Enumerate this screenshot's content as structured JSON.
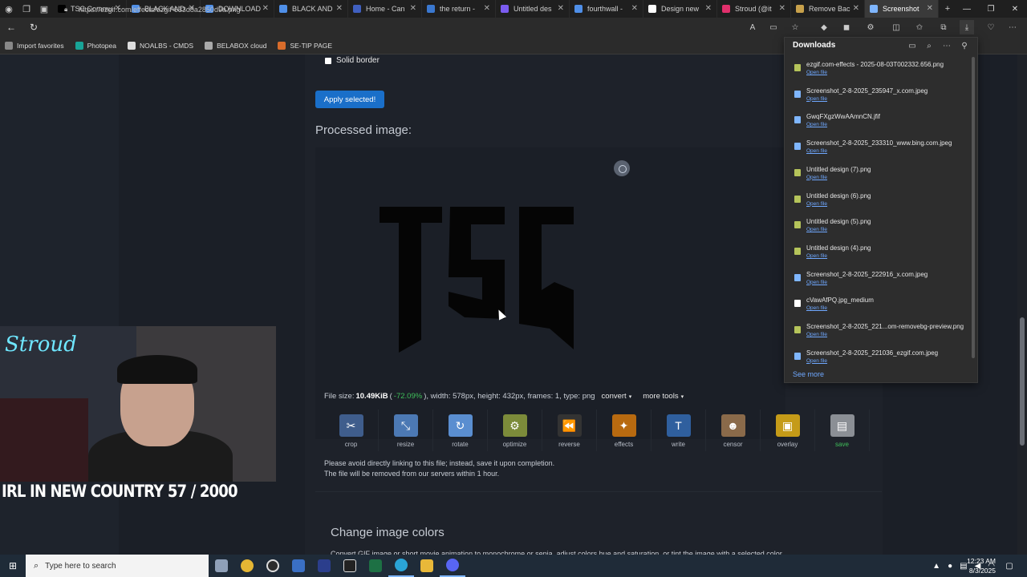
{
  "browser": {
    "tabs": [
      {
        "label": "TSC Commu",
        "color": "#000000"
      },
      {
        "label": "BLACK AND",
        "color": "#4f8fe8"
      },
      {
        "label": "DOWNLOAD",
        "color": "#4f8fe8"
      },
      {
        "label": "BLACK AND",
        "color": "#4f8fe8"
      },
      {
        "label": "Home - Can",
        "color": "#4060c0"
      },
      {
        "label": "the return -",
        "color": "#3a78d0"
      },
      {
        "label": "Untitled des",
        "color": "#7b5cf0"
      },
      {
        "label": "fourthwall -",
        "color": "#4f8fe8"
      },
      {
        "label": "Design new",
        "color": "#ffffff"
      },
      {
        "label": "Stroud (@it",
        "color": "#e1306c"
      },
      {
        "label": "Remove Bac",
        "color": "#c8a14b"
      },
      {
        "label": "Screenshot",
        "color": "#7fb6ff"
      }
    ],
    "new_tab": "+",
    "url": "https://ezgif.com/effects/ezgif-633d8a2850d9a.png",
    "window_controls": {
      "minimize": "—",
      "maximize": "❐",
      "close": "✕"
    }
  },
  "bookmarks": [
    {
      "label": "Import favorites",
      "color": "#888888"
    },
    {
      "label": "Photopea",
      "color": "#18a497"
    },
    {
      "label": "NOALBS - CMDS",
      "color": "#dddddd"
    },
    {
      "label": "BELABOX cloud",
      "color": "#aaaaaa"
    },
    {
      "label": "SE-TIP PAGE",
      "color": "#d96c2b"
    }
  ],
  "page": {
    "checkbox_label": "Solid border",
    "apply_button": "Apply selected!",
    "processed_title": "Processed image:",
    "image_text": "TSC",
    "file_info": {
      "prefix": "File size:",
      "size": "10.49KiB",
      "percent": "-72.09%",
      "rest": ", width: 578px, height: 432px, frames: 1, type: png",
      "convert": "convert",
      "more_tools": "more tools"
    },
    "tools": [
      {
        "label": "crop",
        "icon": "✂",
        "color": "#3f5d8c"
      },
      {
        "label": "resize",
        "icon": "⤡",
        "color": "#4c79b4"
      },
      {
        "label": "rotate",
        "icon": "↻",
        "color": "#5a8ed0"
      },
      {
        "label": "optimize",
        "icon": "⚙",
        "color": "#7c8b3a"
      },
      {
        "label": "reverse",
        "icon": "⏪",
        "color": "#333333"
      },
      {
        "label": "effects",
        "icon": "✦",
        "color": "#b86a10"
      },
      {
        "label": "write",
        "icon": "T",
        "color": "#2f5f9e"
      },
      {
        "label": "censor",
        "icon": "☻",
        "color": "#8a6a4a"
      },
      {
        "label": "overlay",
        "icon": "▣",
        "color": "#c59b18"
      },
      {
        "label": "save",
        "icon": "▤",
        "color": "#8b8f95"
      }
    ],
    "note_line1": "Please avoid directly linking to this file; instead, save it upon completion.",
    "note_line2": "The file will be removed from our servers within 1 hour.",
    "section_title": "Change image colors",
    "section_text": "Convert GIF image or short movie animation to monochrome or sepia, adjust colors hue and saturation, or tint the image with a selected color."
  },
  "downloads": {
    "title": "Downloads",
    "items": [
      {
        "name": "ezgif.com-effects - 2025-08-03T002332.656.png",
        "action": "Open file",
        "color": "#b5c45a"
      },
      {
        "name": "Screenshot_2-8-2025_235947_x.com.jpeg",
        "action": "Open file",
        "color": "#7fb6ff"
      },
      {
        "name": "GwqFXgzWwAAmnCN.jfif",
        "action": "Open file",
        "color": "#7fb6ff"
      },
      {
        "name": "Screenshot_2-8-2025_233310_www.bing.com.jpeg",
        "action": "Open file",
        "color": "#7fb6ff"
      },
      {
        "name": "Untitled design (7).png",
        "action": "Open file",
        "color": "#b5c45a"
      },
      {
        "name": "Untitled design (6).png",
        "action": "Open file",
        "color": "#b5c45a"
      },
      {
        "name": "Untitled design (5).png",
        "action": "Open file",
        "color": "#b5c45a"
      },
      {
        "name": "Untitled design (4).png",
        "action": "Open file",
        "color": "#b5c45a"
      },
      {
        "name": "Screenshot_2-8-2025_222916_x.com.jpeg",
        "action": "Open file",
        "color": "#7fb6ff"
      },
      {
        "name": "cVawAfPQ.jpg_medium",
        "action": "Open file",
        "color": "#ffffff"
      },
      {
        "name": "Screenshot_2-8-2025_221...om-removebg-preview.png",
        "action": "Open file",
        "color": "#b5c45a"
      },
      {
        "name": "Screenshot_2-8-2025_221036_ezgif.com.jpeg",
        "action": "Open file",
        "color": "#7fb6ff"
      }
    ],
    "see_more": "See more"
  },
  "stream": {
    "neon_text": "Stroud",
    "banner": "IRL IN NEW COUNTRY  57 / 2000"
  },
  "taskbar": {
    "search_placeholder": "Type here to search",
    "time": "12:23 AM",
    "date": "8/3/2025"
  }
}
